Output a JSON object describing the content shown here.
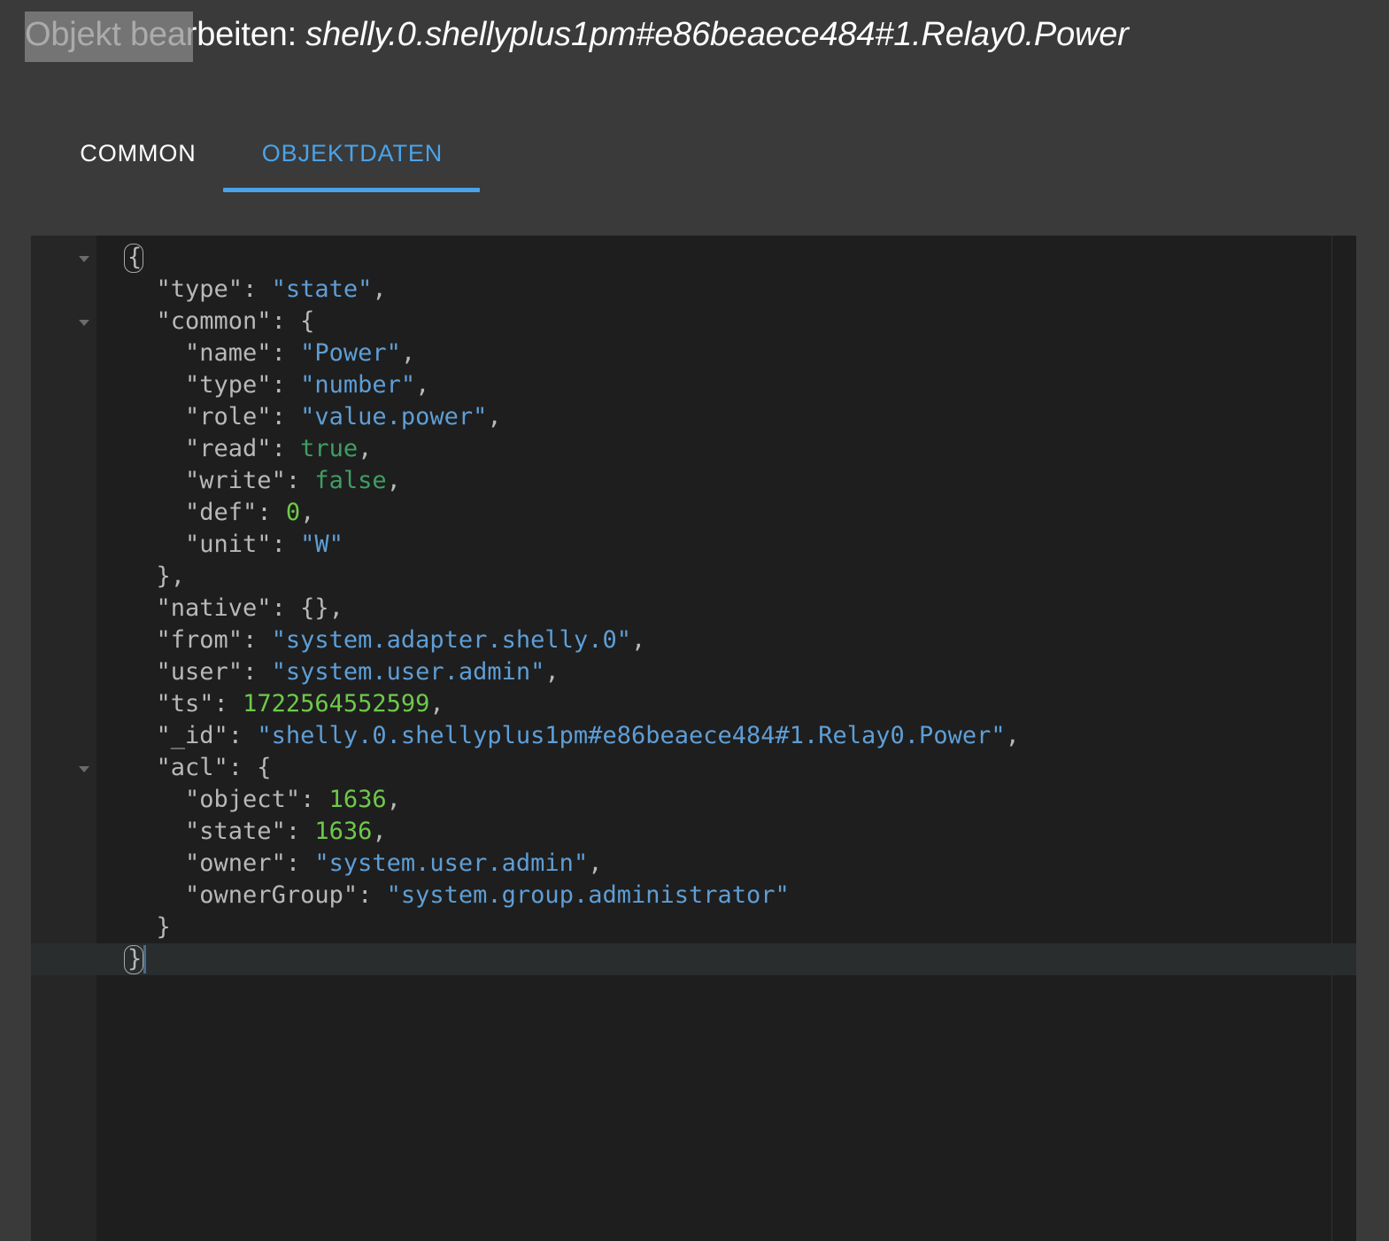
{
  "dialog": {
    "title_label": "Objekt bearbeiten:",
    "title_prefix": "Objekt bearbeiten: ",
    "object_id": "shelly.0.shellyplus1pm#e86beaece484#1.Relay0.Power",
    "overlay_text": "Objekt be"
  },
  "tabs": {
    "common_label": "COMMON",
    "objektdaten_label": "OBJEKTDATEN",
    "active": "OBJEKTDATEN",
    "active_color": "#4aa3e8",
    "inactive_color": "#ffffff"
  },
  "editor": {
    "language": "json",
    "theme_background": "#1e1e1e",
    "gutter_background": "#262626",
    "colors": {
      "key": "#b8b8b8",
      "string": "#5e9ed6",
      "boolean": "#3f9e63",
      "number": "#6ec94a",
      "punctuation": "#b8b8b8",
      "active_line": "#2a2d2e"
    },
    "fold_arrow_lines": [
      1,
      3,
      15
    ],
    "active_line_number": 21,
    "lines": [
      {
        "n": 1,
        "indent": 0,
        "tokens": [
          {
            "t": "{",
            "c": "p"
          }
        ]
      },
      {
        "n": 2,
        "indent": 1,
        "tokens": [
          {
            "t": "\"type\"",
            "c": "k"
          },
          {
            "t": ": ",
            "c": "p"
          },
          {
            "t": "\"state\"",
            "c": "s"
          },
          {
            "t": ",",
            "c": "p"
          }
        ]
      },
      {
        "n": 3,
        "indent": 1,
        "tokens": [
          {
            "t": "\"common\"",
            "c": "k"
          },
          {
            "t": ": {",
            "c": "p"
          }
        ]
      },
      {
        "n": 4,
        "indent": 2,
        "tokens": [
          {
            "t": "\"name\"",
            "c": "k"
          },
          {
            "t": ": ",
            "c": "p"
          },
          {
            "t": "\"Power\"",
            "c": "s"
          },
          {
            "t": ",",
            "c": "p"
          }
        ]
      },
      {
        "n": 5,
        "indent": 2,
        "tokens": [
          {
            "t": "\"type\"",
            "c": "k"
          },
          {
            "t": ": ",
            "c": "p"
          },
          {
            "t": "\"number\"",
            "c": "s"
          },
          {
            "t": ",",
            "c": "p"
          }
        ]
      },
      {
        "n": 6,
        "indent": 2,
        "tokens": [
          {
            "t": "\"role\"",
            "c": "k"
          },
          {
            "t": ": ",
            "c": "p"
          },
          {
            "t": "\"value.power\"",
            "c": "s"
          },
          {
            "t": ",",
            "c": "p"
          }
        ]
      },
      {
        "n": 7,
        "indent": 2,
        "tokens": [
          {
            "t": "\"read\"",
            "c": "k"
          },
          {
            "t": ": ",
            "c": "p"
          },
          {
            "t": "true",
            "c": "b"
          },
          {
            "t": ",",
            "c": "p"
          }
        ]
      },
      {
        "n": 8,
        "indent": 2,
        "tokens": [
          {
            "t": "\"write\"",
            "c": "k"
          },
          {
            "t": ": ",
            "c": "p"
          },
          {
            "t": "false",
            "c": "b"
          },
          {
            "t": ",",
            "c": "p"
          }
        ]
      },
      {
        "n": 9,
        "indent": 2,
        "tokens": [
          {
            "t": "\"def\"",
            "c": "k"
          },
          {
            "t": ": ",
            "c": "p"
          },
          {
            "t": "0",
            "c": "n"
          },
          {
            "t": ",",
            "c": "p"
          }
        ]
      },
      {
        "n": 10,
        "indent": 2,
        "tokens": [
          {
            "t": "\"unit\"",
            "c": "k"
          },
          {
            "t": ": ",
            "c": "p"
          },
          {
            "t": "\"W\"",
            "c": "s"
          }
        ]
      },
      {
        "n": 11,
        "indent": 1,
        "tokens": [
          {
            "t": "},",
            "c": "p"
          }
        ]
      },
      {
        "n": 12,
        "indent": 1,
        "tokens": [
          {
            "t": "\"native\"",
            "c": "k"
          },
          {
            "t": ": {},",
            "c": "p"
          }
        ]
      },
      {
        "n": 13,
        "indent": 1,
        "tokens": [
          {
            "t": "\"from\"",
            "c": "k"
          },
          {
            "t": ": ",
            "c": "p"
          },
          {
            "t": "\"system.adapter.shelly.0\"",
            "c": "s"
          },
          {
            "t": ",",
            "c": "p"
          }
        ]
      },
      {
        "n": 14,
        "indent": 1,
        "tokens": [
          {
            "t": "\"user\"",
            "c": "k"
          },
          {
            "t": ": ",
            "c": "p"
          },
          {
            "t": "\"system.user.admin\"",
            "c": "s"
          },
          {
            "t": ",",
            "c": "p"
          }
        ]
      },
      {
        "n": 15,
        "indent": 1,
        "tokens": [
          {
            "t": "\"ts\"",
            "c": "k"
          },
          {
            "t": ": ",
            "c": "p"
          },
          {
            "t": "1722564552599",
            "c": "n"
          },
          {
            "t": ",",
            "c": "p"
          }
        ]
      },
      {
        "n": 16,
        "indent": 1,
        "tokens": [
          {
            "t": "\"_id\"",
            "c": "k"
          },
          {
            "t": ": ",
            "c": "p"
          },
          {
            "t": "\"shelly.0.shellyplus1pm#e86beaece484#1.Relay0.Power\"",
            "c": "s"
          },
          {
            "t": ",",
            "c": "p"
          }
        ]
      },
      {
        "n": 17,
        "indent": 1,
        "tokens": [
          {
            "t": "\"acl\"",
            "c": "k"
          },
          {
            "t": ": {",
            "c": "p"
          }
        ]
      },
      {
        "n": 18,
        "indent": 2,
        "tokens": [
          {
            "t": "\"object\"",
            "c": "k"
          },
          {
            "t": ": ",
            "c": "p"
          },
          {
            "t": "1636",
            "c": "n"
          },
          {
            "t": ",",
            "c": "p"
          }
        ]
      },
      {
        "n": 19,
        "indent": 2,
        "tokens": [
          {
            "t": "\"state\"",
            "c": "k"
          },
          {
            "t": ": ",
            "c": "p"
          },
          {
            "t": "1636",
            "c": "n"
          },
          {
            "t": ",",
            "c": "p"
          }
        ]
      },
      {
        "n": 20,
        "indent": 2,
        "tokens": [
          {
            "t": "\"owner\"",
            "c": "k"
          },
          {
            "t": ": ",
            "c": "p"
          },
          {
            "t": "\"system.user.admin\"",
            "c": "s"
          },
          {
            "t": ",",
            "c": "p"
          }
        ]
      },
      {
        "n": 21,
        "indent": 2,
        "tokens": [
          {
            "t": "\"ownerGroup\"",
            "c": "k"
          },
          {
            "t": ": ",
            "c": "p"
          },
          {
            "t": "\"system.group.administrator\"",
            "c": "s"
          }
        ]
      },
      {
        "n": 22,
        "indent": 1,
        "tokens": [
          {
            "t": "}",
            "c": "p"
          }
        ]
      },
      {
        "n": 23,
        "indent": 0,
        "tokens": [
          {
            "t": "}",
            "c": "p"
          }
        ]
      }
    ]
  }
}
